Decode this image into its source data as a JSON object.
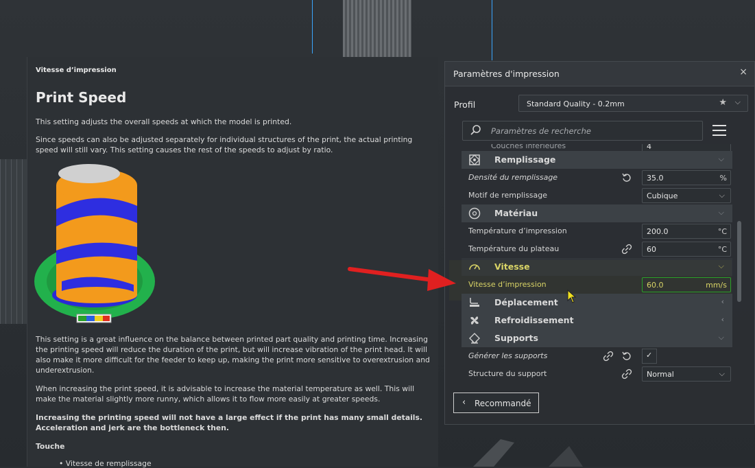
{
  "tooltip": {
    "subtitle": "Vitesse d’impression",
    "title": "Print Speed",
    "p1": "This setting adjusts the overall speeds at which the model is printed.",
    "p2": "Since speeds can also be adjusted separately for individual structures of the print, the actual printing speed will still vary. This setting causes the rest of the speeds to adjust by ratio.",
    "p3": "This setting is a great influence on the balance between printed part quality and printing time. Increasing the printing speed will reduce the duration of the print, but will increase vibration of the print head. It will also make it more difficult for the feeder to keep up, making the print more sensitive to overextrusion and underextrusion.",
    "p4": "When increasing the print speed, it is advisable to increase the material temperature as well. This will make the material slightly more runny, which allows it to flow more easily at greater speeds.",
    "p5": "Increasing the printing speed will not have a large effect if the print has many small details. Acceleration and jerk are the bottleneck then.",
    "affects": "Touche",
    "bullet": "• Vitesse de remplissage"
  },
  "panel": {
    "title": "Paramètres d'impression",
    "close": "×",
    "profile_label": "Profil",
    "profile_value": "Standard Quality - 0.2mm",
    "search_placeholder": "Paramètres de recherche",
    "recommended_label": "Recommandé"
  },
  "settings": {
    "partial_label": "Couches inférieures",
    "partial_value": "4",
    "infill": {
      "label": "Remplissage",
      "density_label": "Densité du remplissage",
      "density_value": "35.0",
      "density_unit": "%",
      "pattern_label": "Motif de remplissage",
      "pattern_value": "Cubique"
    },
    "material": {
      "label": "Matériau",
      "print_temp_label": "Température d’impression",
      "print_temp_value": "200.0",
      "print_temp_unit": "°C",
      "bed_temp_label": "Température du plateau",
      "bed_temp_value": "60",
      "bed_temp_unit": "°C"
    },
    "speed": {
      "label": "Vitesse",
      "print_speed_label": "Vitesse d’impression",
      "print_speed_value": "60.0",
      "print_speed_unit": "mm/s"
    },
    "travel": {
      "label": "Déplacement"
    },
    "cooling": {
      "label": "Refroidissement"
    },
    "supports": {
      "label": "Supports",
      "generate_label": "Générer les supports",
      "generate_checked": "✓",
      "structure_label": "Structure du support",
      "structure_value": "Normal"
    }
  },
  "colors": {
    "highlight": "#96961466",
    "accent_green": "#2aa02a",
    "arrow_red": "#e02020"
  }
}
